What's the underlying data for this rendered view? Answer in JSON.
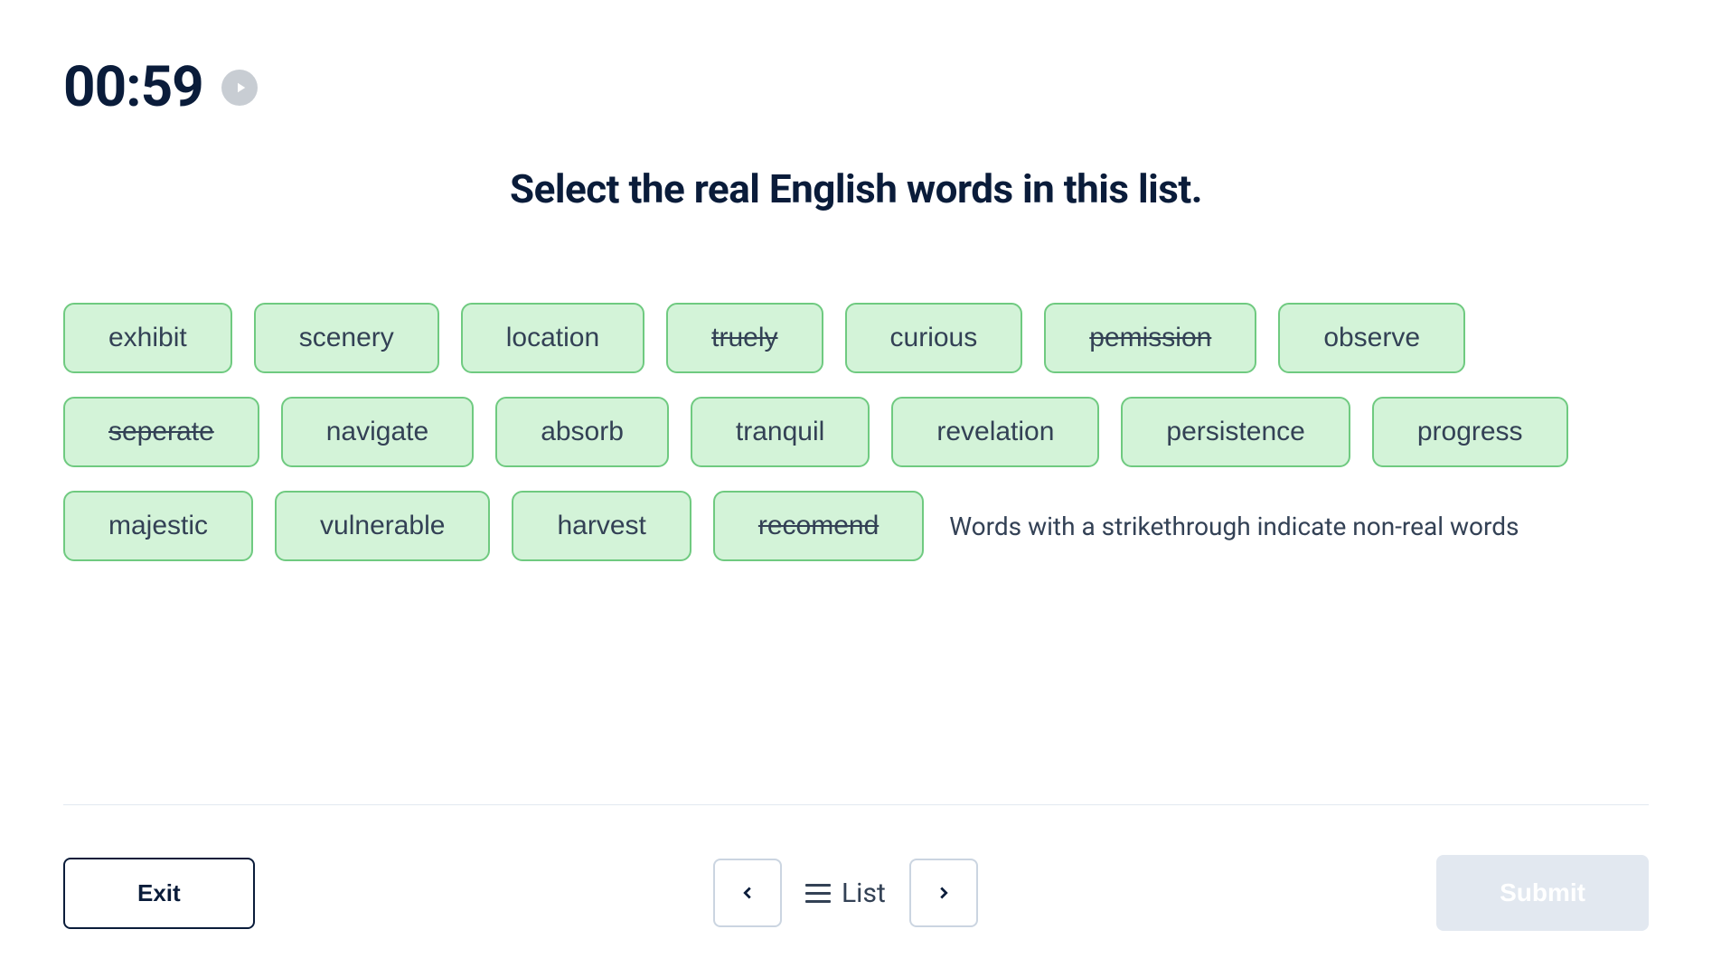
{
  "timer": "00:59",
  "question": "Select the real English words in this list.",
  "words": [
    {
      "text": "exhibit",
      "strikethrough": false
    },
    {
      "text": "scenery",
      "strikethrough": false
    },
    {
      "text": "location",
      "strikethrough": false
    },
    {
      "text": "truely",
      "strikethrough": true
    },
    {
      "text": "curious",
      "strikethrough": false
    },
    {
      "text": "pemission",
      "strikethrough": true
    },
    {
      "text": "observe",
      "strikethrough": false
    },
    {
      "text": "seperate",
      "strikethrough": true
    },
    {
      "text": "navigate",
      "strikethrough": false
    },
    {
      "text": "absorb",
      "strikethrough": false
    },
    {
      "text": "tranquil",
      "strikethrough": false
    },
    {
      "text": "revelation",
      "strikethrough": false
    },
    {
      "text": "persistence",
      "strikethrough": false
    },
    {
      "text": "progress",
      "strikethrough": false
    },
    {
      "text": "majestic",
      "strikethrough": false
    },
    {
      "text": "vulnerable",
      "strikethrough": false
    },
    {
      "text": "harvest",
      "strikethrough": false
    },
    {
      "text": "recomend",
      "strikethrough": true
    }
  ],
  "hint": "Words with a strikethrough indicate non-real words",
  "footer": {
    "exit": "Exit",
    "list_label": "List",
    "submit": "Submit"
  }
}
